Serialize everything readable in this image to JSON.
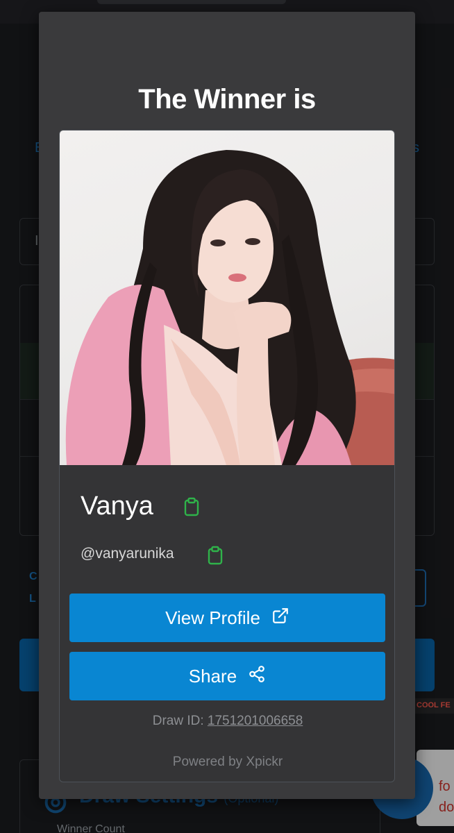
{
  "modal": {
    "title": "The Winner is",
    "winner": {
      "name": "Vanya",
      "handle": "@vanyarunika",
      "photo_icon": "profile-photo"
    },
    "view_profile_label": "View Profile",
    "share_label": "Share",
    "draw_id_prefix": "Draw ID:",
    "draw_id_value": "1751201006658",
    "powered_by": "Powered by Xpickr"
  },
  "background": {
    "tab_left_letter": "E",
    "tab_right_letter": "s",
    "input_letter": "I",
    "row_label_c": "C",
    "row_label_l": "L",
    "badge_text": "COOL FE",
    "settings_title": "Draw Settings",
    "settings_optional": "(Optional)",
    "settings_sub": "Winner Count",
    "float_text_1": "fo",
    "float_text_2": "do"
  },
  "colors": {
    "accent": "#0986d2",
    "copy_icon": "#2fb34a",
    "modal_bg": "#3a3a3c"
  },
  "icons": [
    "clipboard-icon",
    "external-link-icon",
    "share-icon",
    "gear-icon"
  ]
}
